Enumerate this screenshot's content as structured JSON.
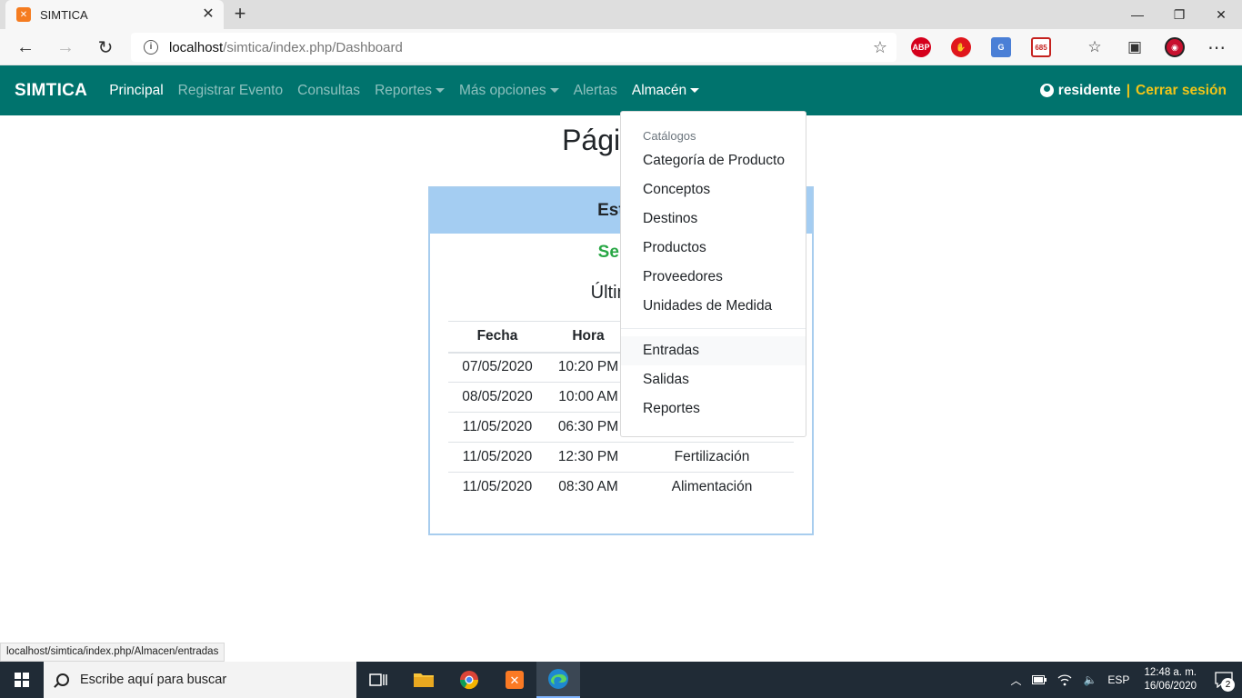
{
  "browser": {
    "tab_title": "SIMTICA",
    "url_host": "localhost",
    "url_path": "/simtica/index.php/Dashboard",
    "extensions": [
      {
        "name": "adblock-plus-icon",
        "label": "ABP",
        "color": "#d5001c"
      },
      {
        "name": "ublock-icon",
        "label": "",
        "color": "#e0161c"
      },
      {
        "name": "translate-icon",
        "label": "G",
        "color": "#4a7fd6"
      },
      {
        "name": "gmail-icon",
        "label": "685",
        "color": "#c5221f"
      }
    ]
  },
  "navbar": {
    "brand": "SIMTICA",
    "items": [
      {
        "label": "Principal",
        "active": true,
        "dropdown": false
      },
      {
        "label": "Registrar Evento",
        "active": false,
        "dropdown": false
      },
      {
        "label": "Consultas",
        "active": false,
        "dropdown": false
      },
      {
        "label": "Reportes",
        "active": false,
        "dropdown": true
      },
      {
        "label": "Más opciones",
        "active": false,
        "dropdown": true
      },
      {
        "label": "Alertas",
        "active": false,
        "dropdown": false
      },
      {
        "label": "Almacén",
        "active": true,
        "dropdown": true
      }
    ],
    "user": "residente",
    "separator": "|",
    "logout": "Cerrar sesión",
    "colors": {
      "background": "#00736d",
      "accent": "#f0c419"
    }
  },
  "main": {
    "title": "Página P",
    "card": {
      "header": "Estan",
      "subheader": "Sema",
      "subtitle": "Últimos",
      "columns": [
        "Fecha",
        "Hora",
        ""
      ],
      "rows": [
        {
          "fecha": "07/05/2020",
          "hora": "10:20 PM",
          "evento": ""
        },
        {
          "fecha": "08/05/2020",
          "hora": "10:00 AM",
          "evento": ""
        },
        {
          "fecha": "11/05/2020",
          "hora": "06:30 PM",
          "evento": ""
        },
        {
          "fecha": "11/05/2020",
          "hora": "12:30 PM",
          "evento": "Fertilización"
        },
        {
          "fecha": "11/05/2020",
          "hora": "08:30 AM",
          "evento": "Alimentación"
        }
      ]
    }
  },
  "dropdown": {
    "header": "Catálogos",
    "catalog_items": [
      "Categoría de Producto",
      "Conceptos",
      "Destinos",
      "Productos",
      "Proveedores",
      "Unidades de Medida"
    ],
    "operation_items": [
      "Entradas",
      "Salidas",
      "Reportes"
    ],
    "hovered": "Entradas"
  },
  "statusbar": {
    "link": "localhost/simtica/index.php/Almacen/entradas"
  },
  "taskbar": {
    "search_placeholder": "Escribe aquí para buscar",
    "language": "ESP",
    "time": "12:48 a. m.",
    "date": "16/06/2020",
    "notifications": "2"
  }
}
